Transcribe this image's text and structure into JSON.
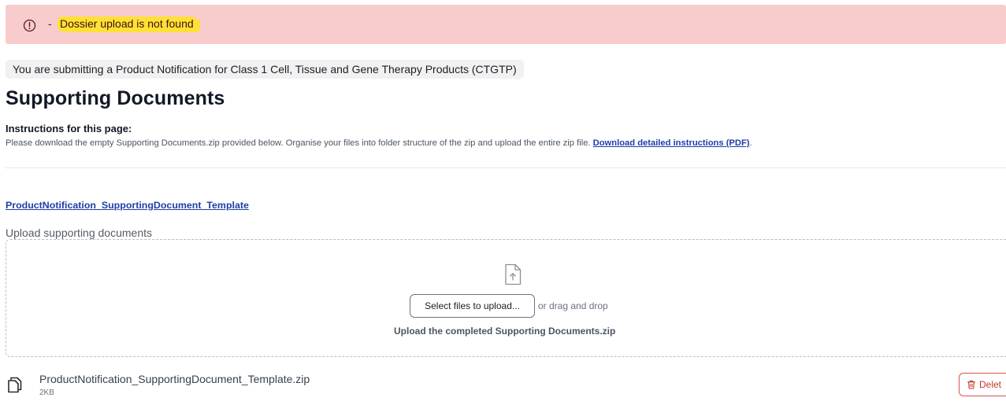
{
  "error_banner": {
    "icon": "exclamation-circle-icon",
    "separator": "-",
    "message": "Dossier upload is not found",
    "highlight_color": "#ffe135",
    "background_color": "#f8cccc"
  },
  "context": {
    "text": "You are submitting a Product Notification for Class 1 Cell, Tissue and Gene Therapy Products (CTGTP)"
  },
  "page": {
    "title": "Supporting Documents"
  },
  "instructions": {
    "title": "Instructions for this page:",
    "text": "Please download the empty Supporting Documents.zip provided below. Organise your files into folder structure of the zip and upload the entire zip file. ",
    "link_label": "Download detailed instructions (PDF)",
    "trailing": "."
  },
  "template_link": {
    "label": "ProductNotification_SupportingDocument_Template"
  },
  "upload": {
    "label": "Upload supporting documents",
    "icon": "file-upload-icon",
    "select_button": "Select files to upload...",
    "drag_text": "or drag and drop",
    "hint": "Upload the completed Supporting Documents.zip"
  },
  "uploaded_file": {
    "icon": "copy-file-icon",
    "name": "ProductNotification_SupportingDocument_Template.zip",
    "size": "2KB",
    "delete_label": "Delet",
    "delete_icon": "trash-icon"
  },
  "colors": {
    "link": "#1d3fa8",
    "danger": "#c0392b"
  }
}
